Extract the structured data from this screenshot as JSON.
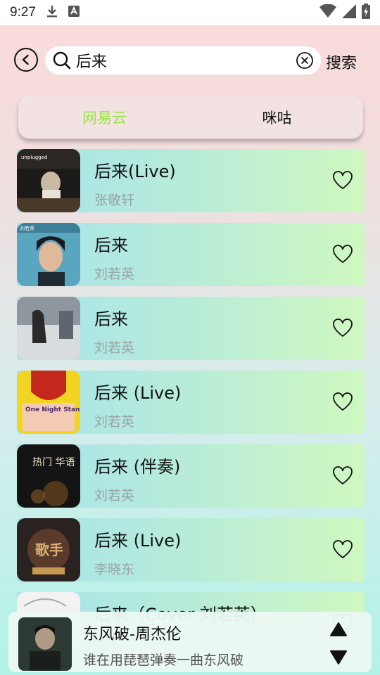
{
  "status": {
    "time": "9:27"
  },
  "search": {
    "query": "后来",
    "action_label": "搜索"
  },
  "tabs": [
    {
      "label": "网易云",
      "active": true
    },
    {
      "label": "咪咕",
      "active": false
    }
  ],
  "songs": [
    {
      "title": "后来(Live)",
      "artist": "张敬轩"
    },
    {
      "title": "后来",
      "artist": "刘若英"
    },
    {
      "title": "后来",
      "artist": "刘若英"
    },
    {
      "title": "后来 (Live)",
      "artist": "刘若英"
    },
    {
      "title": "后来 (伴奏)",
      "artist": "刘若英"
    },
    {
      "title": "后来 (Live)",
      "artist": "李晓东"
    },
    {
      "title": "后来（Cover 刘若英）",
      "artist": ""
    }
  ],
  "covers": [
    {
      "text": "unplugged"
    },
    {
      "text": "刘若英"
    },
    {
      "text": ""
    },
    {
      "text": "One Night Stand Renee"
    },
    {
      "text": "热门 华语"
    },
    {
      "text": "歌手"
    },
    {
      "text": ""
    }
  ],
  "player": {
    "title": "东风破-周杰伦",
    "subtitle": "谁在用琵琶弹奏一曲东风破"
  },
  "colors": {
    "active_tab": "#9be14a",
    "artist_text": "#9aa5a5"
  }
}
